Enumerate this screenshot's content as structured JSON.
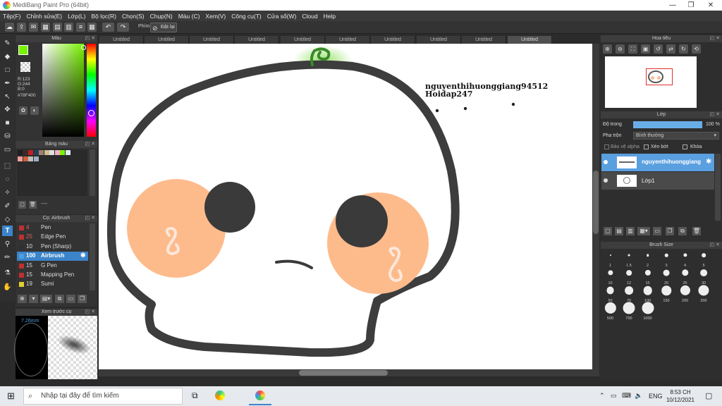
{
  "window": {
    "title": "MediBang Paint Pro (64bit)",
    "controls": [
      "—",
      "❐",
      "✕"
    ]
  },
  "menu": [
    "Tệp(F)",
    "Chỉnh sửa(E)",
    "Lớp(L)",
    "Bộ lọc(R)",
    "Chọn(S)",
    "Chụp(N)",
    "Màu (C)",
    "Xem(V)",
    "Công cụ(T)",
    "Cửa sổ(W)",
    "Cloud",
    "Help"
  ],
  "toolbar": {
    "phim_label": "Phím",
    "reset_label": "Đặt lại"
  },
  "color_panel": {
    "title": "Màu",
    "r": "R:123",
    "g": "G:244",
    "b": "B:0",
    "hex": "#78F400",
    "current_color": "#78f400"
  },
  "palette_panel": {
    "title": "Bảng màu",
    "swatches": [
      "#202020",
      "#3a2a2a",
      "#c02020",
      "#204060",
      "#a08070",
      "#d0c090",
      "#e0e0e0",
      "#f4b0c0",
      "#78f400",
      "#e0e8f0",
      "#f0a0a0",
      "#d06040",
      "#c0c0c0",
      "#a0b0c0"
    ],
    "status": "----"
  },
  "brush_panel": {
    "title": "Cọ: Airbrush",
    "items": [
      {
        "size": "4",
        "name": "Pen",
        "color": "#c03030"
      },
      {
        "size": "25",
        "name": "Edge Pen",
        "color": "#c03030"
      },
      {
        "size": "10",
        "name": "Pen (Sharp)",
        "color": "#303030"
      },
      {
        "size": "100",
        "name": "Airbrush",
        "color": "#4c9ee0"
      },
      {
        "size": "15",
        "name": "G Pen",
        "color": "#c03030"
      },
      {
        "size": "15",
        "name": "Mapping Pen",
        "color": "#c03030"
      },
      {
        "size": "19",
        "name": "Sumi",
        "color": "#e0d030"
      }
    ]
  },
  "preview_panel": {
    "title": "Xem trước cọ",
    "size": "7.26mm"
  },
  "tabs": [
    "Untitled",
    "Untitled",
    "Untitled",
    "Untitled",
    "Untitled",
    "Untitled",
    "Untitled",
    "Untitled",
    "Untitled",
    "Untitled"
  ],
  "canvas": {
    "text_line1": "nguyenthihuonggiang94512",
    "text_line2": "Hoidap247"
  },
  "navigator_panel": {
    "title": "Hoa tiêu"
  },
  "layer_panel": {
    "title": "Lớp",
    "opacity_label": "Độ trong",
    "opacity_value": "100 %",
    "opacity_fraction": 1.0,
    "blend_label": "Pha trộn",
    "blend_value": "Bình thường",
    "protect_alpha": "Bảo vệ alpha",
    "clip": "Xén bớt",
    "lock": "Khóa",
    "layers": [
      {
        "name": "nguyenthihuonggiang"
      },
      {
        "name": "Lớp1"
      }
    ]
  },
  "brush_size_panel": {
    "title": "Brush Size",
    "sizes": [
      "1",
      "1.5",
      "2",
      "3",
      "4",
      "5",
      "10",
      "12",
      "15",
      "20",
      "25",
      "30",
      "50",
      "70",
      "100",
      "150",
      "200",
      "300",
      "500",
      "700",
      "1000"
    ]
  },
  "taskbar": {
    "search_placeholder": "Nhập tại đây để tìm kiếm",
    "lang": "ENG",
    "time": "8:53 CH",
    "date": "10/12/2021"
  }
}
